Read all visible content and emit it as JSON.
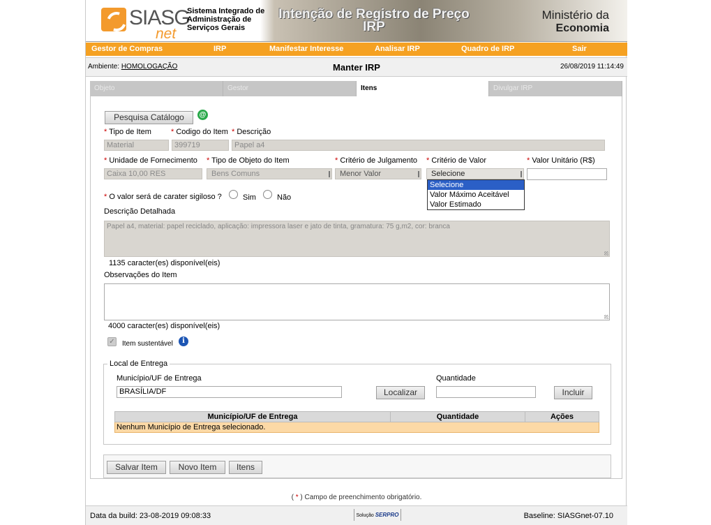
{
  "header": {
    "logo_text": "SIASG",
    "logo_net": "net",
    "system_name": "Sistema Integrado de Administração de Serviços Gerais",
    "banner_title_1": "Intenção de Registro de Preço",
    "banner_title_2": "IRP",
    "ministry_1": "Ministério da",
    "ministry_2": "Economia"
  },
  "menu": [
    "Gestor de Compras",
    "IRP",
    "Manifestar Interesse",
    "Analisar IRP",
    "Quadro de IRP",
    "Sair"
  ],
  "envbar": {
    "env_label": "Ambiente:",
    "env_value": "HOMOLOGAÇÃO",
    "page_title": "Manter IRP",
    "datetime": "26/08/2019 11:14:49"
  },
  "tabs": [
    {
      "label": "Objeto",
      "active": false
    },
    {
      "label": "Gestor",
      "active": false
    },
    {
      "label": "Itens",
      "active": true
    },
    {
      "label": "Divulgar IRP",
      "active": false
    }
  ],
  "form": {
    "catalog_button": "Pesquisa Catálogo",
    "catalog_icon": "@",
    "tipo_item_label": "Tipo de Item",
    "tipo_item_value": "Material",
    "codigo_item_label": "Codigo do Item",
    "codigo_item_value": "399719",
    "descricao_label": "Descrição",
    "descricao_value": "Papel a4",
    "unidade_label": "Unidade de Fornecimento",
    "unidade_value": "Caixa 10,00 RES",
    "tipo_objeto_label": "Tipo de Objeto do Item",
    "tipo_objeto_value": "Bens Comuns",
    "criterio_julg_label": "Critério de Julgamento",
    "criterio_julg_value": "Menor Valor",
    "criterio_valor_label": "Critério de Valor",
    "criterio_valor_value": "Selecione",
    "criterio_valor_options": [
      "Selecione",
      "Valor Máximo Aceitável",
      "Valor Estimado"
    ],
    "valor_unit_label": "Valor Unitário (R$)",
    "valor_unit_value": "",
    "sigiloso_label": "O valor será de carater sigiloso ?",
    "sim_label": "Sim",
    "nao_label": "Não",
    "desc_det_label": "Descrição Detalhada",
    "desc_det_value": "Papel a4, material: papel reciclado, aplicação: impressora laser e jato de tinta, gramatura: 75 g,m2, cor: branca",
    "desc_det_chars": "1135 caracter(es) disponível(eis)",
    "obs_label": "Observações do Item",
    "obs_value": "",
    "obs_chars": "4000 caracter(es) disponível(eis)",
    "sustentavel_check": "✓",
    "sustentavel_label": "Item sustentável",
    "info_icon": "i",
    "required_mark": "*"
  },
  "local_entrega": {
    "legend": "Local de Entrega",
    "municipio_label": "Município/UF de Entrega",
    "municipio_value": "BRASÍLIA/DF",
    "localizar_button": "Localizar",
    "quantidade_label": "Quantidade",
    "quantidade_value": "",
    "incluir_button": "Incluir",
    "table_headers": [
      "Município/UF de Entrega",
      "Quantidade",
      "Ações"
    ],
    "empty_row": "Nenhum Município de Entrega selecionado."
  },
  "actions": [
    "Salvar Item",
    "Novo Item",
    "Itens"
  ],
  "footnote_open": "(",
  "footnote_mark": "*",
  "footnote_text": ") Campo de preenchimento obrigatório.",
  "footer": {
    "build": "Data da build: 23-08-2019 09:08:33",
    "solucao": "Solução",
    "serpro": "SERPRO",
    "baseline": "Baseline: SIASGnet-07.10"
  },
  "colors": {
    "menu": "#f5a122",
    "accent": "#f39a2d",
    "row_bg": "#fcd9a6"
  }
}
